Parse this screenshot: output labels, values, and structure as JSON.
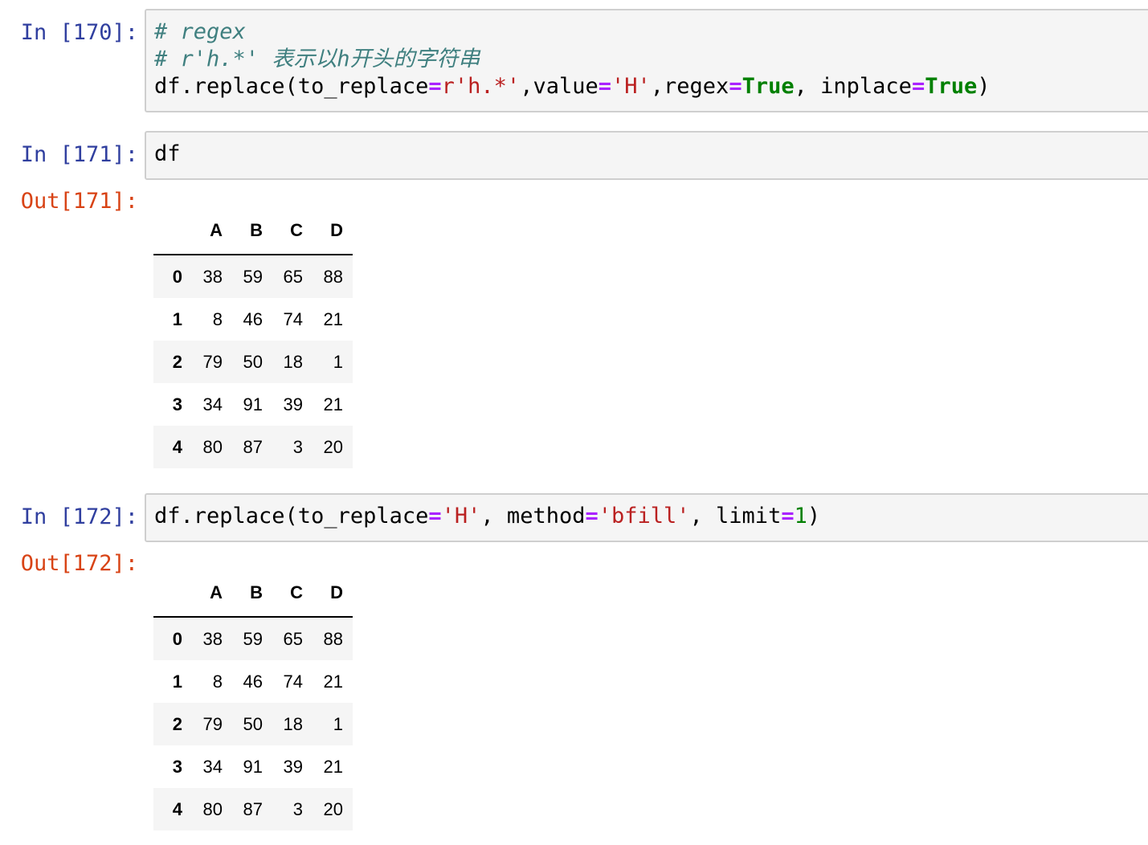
{
  "cells": [
    {
      "in_prompt": "In [170]:",
      "lines": [
        "# regex",
        "# r'h.*' 表示以h开头的字符串"
      ],
      "code": {
        "fn": "df.replace(to_replace",
        "eq1": "=",
        "s1": "r'h.*'",
        "t1": ",value",
        "eq2": "=",
        "s2": "'H'",
        "t2": ",regex",
        "eq3": "=",
        "k1": "True",
        "t3": ", inplace",
        "eq4": "=",
        "k2": "True",
        "t4": ")"
      }
    },
    {
      "in_prompt": "In [171]:",
      "code": "df",
      "out_prompt": "Out[171]:"
    },
    {
      "in_prompt": "In [172]:",
      "code": {
        "fn": "df.replace(to_replace",
        "eq1": "=",
        "s1": "'H'",
        "t1": ", method",
        "eq2": "=",
        "s2": "'bfill'",
        "t2": ", limit",
        "eq3": "=",
        "n1": "1",
        "t3": ")"
      },
      "out_prompt": "Out[172]:"
    }
  ],
  "table": {
    "columns": [
      "A",
      "B",
      "C",
      "D"
    ],
    "rows": [
      {
        "index": "0",
        "values": [
          "38",
          "59",
          "65",
          "88"
        ]
      },
      {
        "index": "1",
        "values": [
          "8",
          "46",
          "74",
          "21"
        ]
      },
      {
        "index": "2",
        "values": [
          "79",
          "50",
          "18",
          "1"
        ]
      },
      {
        "index": "3",
        "values": [
          "34",
          "91",
          "39",
          "21"
        ]
      },
      {
        "index": "4",
        "values": [
          "80",
          "87",
          "3",
          "20"
        ]
      }
    ]
  }
}
